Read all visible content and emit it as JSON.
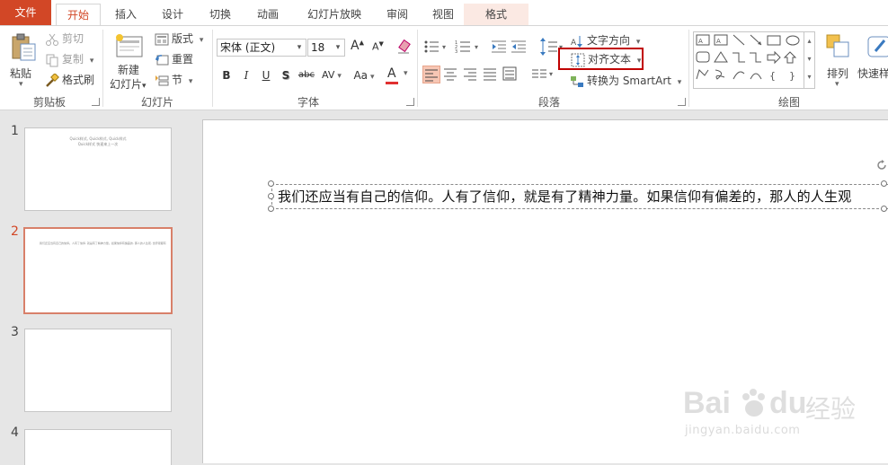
{
  "tabs": [
    "文件",
    "开始",
    "插入",
    "设计",
    "切换",
    "动画",
    "幻灯片放映",
    "审阅",
    "视图",
    "格式"
  ],
  "clipboard": {
    "paste": "粘贴",
    "cut": "剪切",
    "copy": "复制",
    "format_painter": "格式刷",
    "label": "剪贴板"
  },
  "slides_group": {
    "new_slide_line1": "新建",
    "new_slide_line2": "幻灯片",
    "layout": "版式",
    "reset": "重置",
    "section": "节",
    "label": "幻灯片"
  },
  "font_group": {
    "font_name": "宋体 (正文)",
    "font_size": "18",
    "bold": "B",
    "italic": "I",
    "underline": "U",
    "shadow": "S",
    "strike": "abc",
    "spacing": "AV",
    "case": "Aa",
    "color": "A",
    "label": "字体"
  },
  "paragraph_group": {
    "text_direction": "文字方向",
    "align_text": "对齐文本",
    "convert_smartart": "转换为 SmartArt",
    "label": "段落"
  },
  "drawing_group": {
    "arrange": "排列",
    "quick_styles": "快速样",
    "label": "绘图"
  },
  "thumbnails": [
    {
      "num": "1",
      "lines": [
        "Quick样式, Quick样式, Quick样式",
        "Quick样式  快速来上一次"
      ]
    },
    {
      "num": "2",
      "lines": [
        "我们还应当有自己的信仰。人有了信仰, 就是有了精神力量。如果信仰有偏差的, 那人的人生观, 世界观都有"
      ]
    },
    {
      "num": "3",
      "lines": []
    },
    {
      "num": "4",
      "lines": []
    }
  ],
  "slide_text": "我们还应当有自己的信仰。人有了信仰，就是有了精神力量。如果信仰有偏差的，那人的人生观",
  "watermark": {
    "brand": "Bai",
    "brand2": "du",
    "brand_cn": "经验",
    "url": "jingyan.baidu.com"
  },
  "colors": {
    "accent": "#d24726",
    "highlight_box": "#c00000",
    "selected_thumb": "#d8806a"
  }
}
